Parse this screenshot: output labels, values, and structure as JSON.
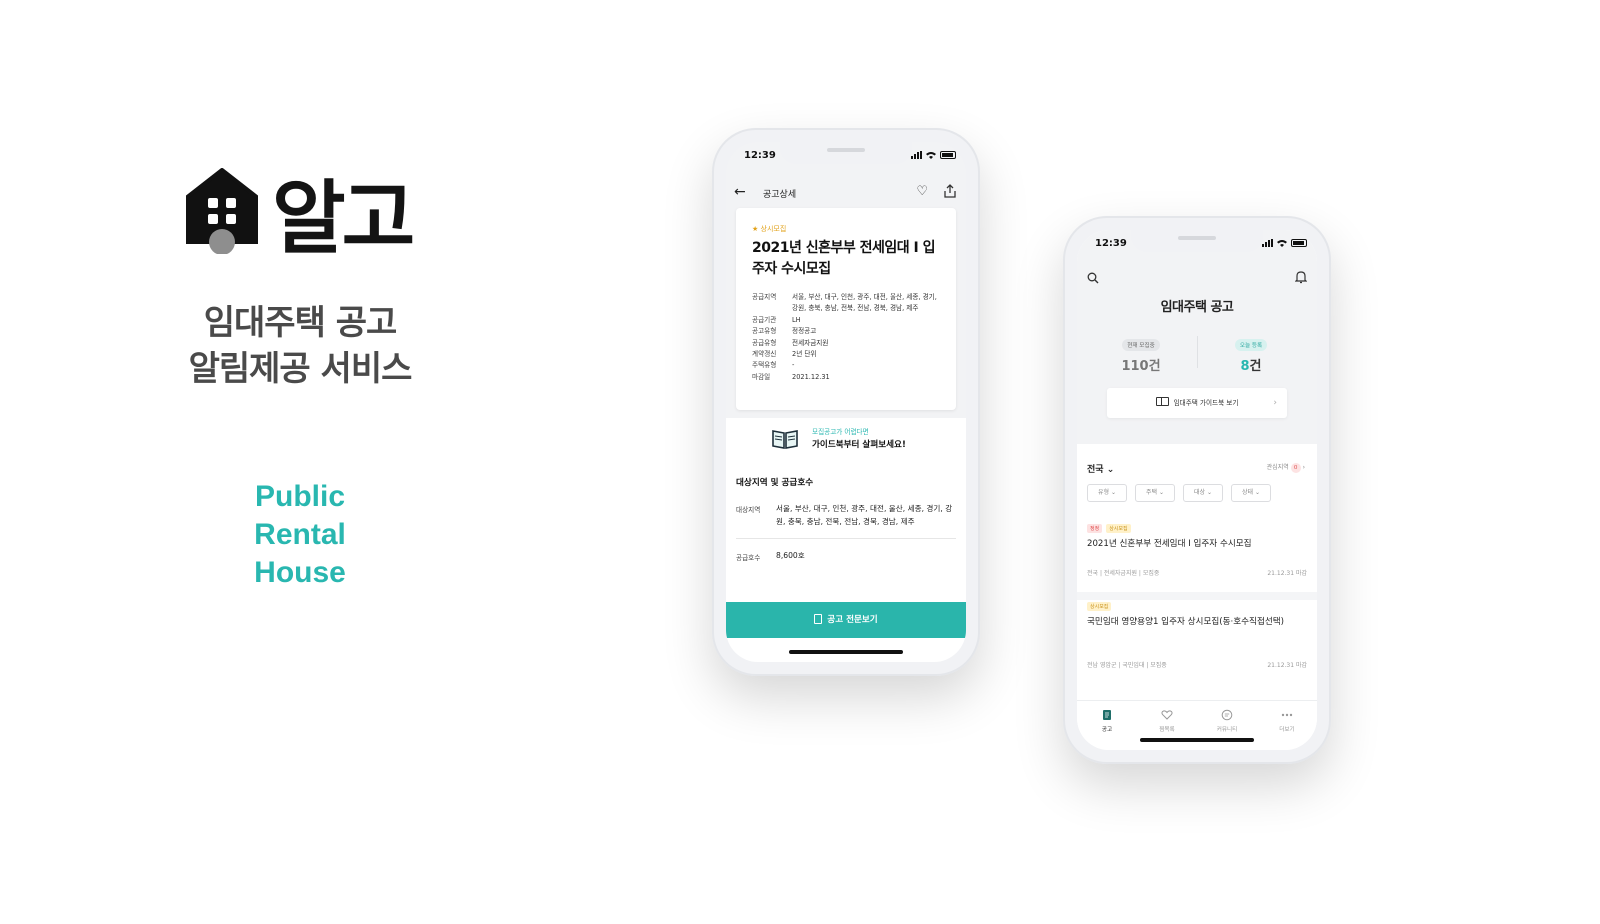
{
  "brand": {
    "name": "알고",
    "tagline_line1": "임대주택 공고",
    "tagline_line2": "알림제공 서비스",
    "english_line1": "Public",
    "english_line2": "Rental",
    "english_line3": "House",
    "accent_color": "#29b7b0"
  },
  "phone_detail": {
    "status_time": "12:39",
    "header_title": "공고상세",
    "icons": [
      "back-arrow-icon",
      "heart-icon",
      "share-icon"
    ],
    "badge": "상시모집",
    "title": "2021년 신혼부부 전세임대 I 입주자 수시모집",
    "info_rows": [
      {
        "key": "공급지역",
        "value": "서울, 부산, 대구, 인천, 광주, 대전, 울산, 세종, 경기, 강원, 충북, 충남, 전북, 전남, 경북, 경남, 제주"
      },
      {
        "key": "공급기관",
        "value": "LH"
      },
      {
        "key": "공고유형",
        "value": "정정공고"
      },
      {
        "key": "공급유형",
        "value": "전세자금지원"
      },
      {
        "key": "계약갱신",
        "value": "2년 단위"
      },
      {
        "key": "주택유형",
        "value": "-"
      },
      {
        "key": "마감일",
        "value": "2021.12.31"
      }
    ],
    "guide_sub": "모집공고가 어렵다면",
    "guide_main": "가이드북부터 살펴보세요!",
    "section_heading": "대상지역 및 공급호수",
    "target_region_label": "대상지역",
    "target_region_value": "서울, 부산, 대구, 인천, 광주, 대전, 울산, 세종, 경기, 강원, 충북, 충남, 전북, 전남, 경북, 경남, 제주",
    "supply_count_label": "공급호수",
    "supply_count_value": "8,600호",
    "cta_label": "공고 전문보기"
  },
  "phone_list": {
    "status_time": "12:39",
    "title": "임대주택 공고",
    "stat_current_label": "현재 모집중",
    "stat_current_value": "110건",
    "stat_today_label": "오늘 등록",
    "stat_today_number": "8",
    "stat_today_unit": "건",
    "guide_button": "임대주택 가이드북 보기",
    "region": "전국",
    "interest_label": "관심지역",
    "interest_count": "0",
    "filters": [
      "유형",
      "주택",
      "대상",
      "상태"
    ],
    "items": [
      {
        "tags": [
          "정정",
          "상시모집"
        ],
        "title": "2021년 신혼부부 전세임대 I  입주자 수시모집",
        "meta": "전국 | 전세자금지원 | 모집중",
        "due": "21.12.31 마감"
      },
      {
        "tags": [
          "상시모집"
        ],
        "title": "국민임대 영양용양1 입주자 상시모집(동·호수직접선택)",
        "meta": "전남 영암군 | 국민임대 | 모집중",
        "due": "21.12.31 마감"
      }
    ],
    "tabs": [
      {
        "label": "공고",
        "icon": "notice-icon"
      },
      {
        "label": "찜목록",
        "icon": "heart-list-icon"
      },
      {
        "label": "커뮤니티",
        "icon": "chat-icon"
      },
      {
        "label": "더보기",
        "icon": "more-icon"
      }
    ]
  }
}
